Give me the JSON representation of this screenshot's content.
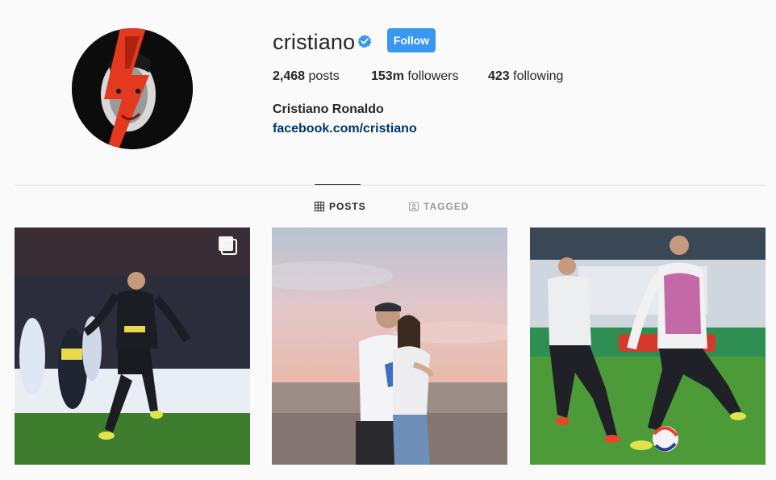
{
  "profile": {
    "username": "cristiano",
    "verified": true,
    "follow_label": "Follow",
    "full_name": "Cristiano Ronaldo",
    "website": "facebook.com/cristiano"
  },
  "stats": {
    "posts_count": "2,468",
    "posts_label": "posts",
    "followers_count": "153m",
    "followers_label": "followers",
    "following_count": "423",
    "following_label": "following"
  },
  "tabs": [
    {
      "label": "POSTS",
      "icon": "grid-icon",
      "active": true
    },
    {
      "label": "TAGGED",
      "icon": "tag-icon",
      "active": false
    }
  ],
  "colors": {
    "follow_button": "#3897f0",
    "link": "#003569",
    "verified_badge": "#3897f0",
    "inactive_tab": "#999999"
  },
  "posts": [
    {
      "subject": "soccer-penalty-kick-photo",
      "multi_image": true
    },
    {
      "subject": "couple-embrace-desert-sunset-photo",
      "multi_image": false
    },
    {
      "subject": "soccer-training-drill-photo",
      "multi_image": false
    }
  ]
}
